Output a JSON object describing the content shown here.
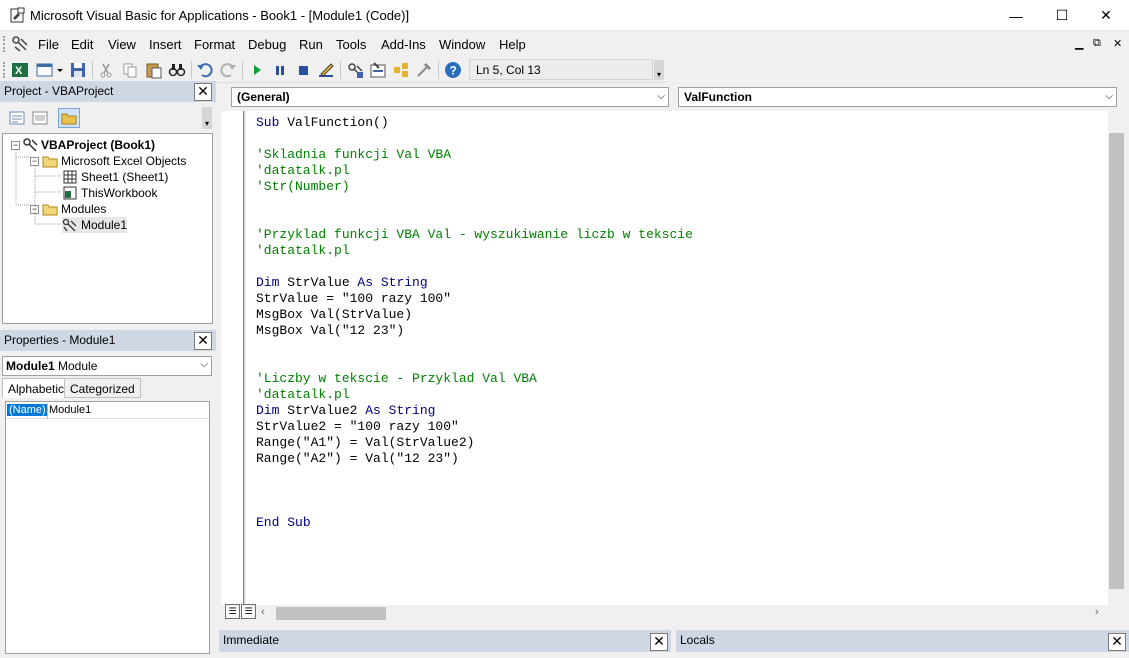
{
  "window": {
    "title": "Microsoft Visual Basic for Applications - Book1 - [Module1 (Code)]",
    "minimize": "—",
    "maximize": "☐",
    "close": "✕"
  },
  "menu": {
    "items": [
      "File",
      "Edit",
      "View",
      "Insert",
      "Format",
      "Debug",
      "Run",
      "Tools",
      "Add-Ins",
      "Window",
      "Help"
    ],
    "mdi_minimize": "▁",
    "mdi_restore": "⧉",
    "mdi_close": "✕"
  },
  "toolbar": {
    "status": "Ln 5, Col 13"
  },
  "project": {
    "title": "Project - VBAProject",
    "close": "✕",
    "tree": {
      "root": "VBAProject (Book1)",
      "folder_objects": "Microsoft Excel Objects",
      "sheet1": "Sheet1 (Sheet1)",
      "workbook": "ThisWorkbook",
      "folder_modules": "Modules",
      "module1": "Module1"
    }
  },
  "properties": {
    "title": "Properties - Module1",
    "close": "✕",
    "object_name": "Module1",
    "object_type": "Module",
    "tabs": [
      "Alphabetic",
      "Categorized"
    ],
    "row_name": "(Name)",
    "row_value": "Module1"
  },
  "code": {
    "object_combo": "(General)",
    "procedure_combo": "ValFunction",
    "lines": [
      {
        "text": "Sub ValFunction()",
        "kind": "keyword"
      },
      {
        "text": "",
        "kind": "plain"
      },
      {
        "text": "'Skladnia funkcji Val VBA",
        "kind": "comment"
      },
      {
        "text": "'datatalk.pl",
        "kind": "comment"
      },
      {
        "text": "'Str(Number)",
        "kind": "comment"
      },
      {
        "text": "",
        "kind": "plain"
      },
      {
        "text": "",
        "kind": "plain"
      },
      {
        "text": "'Przyklad funkcji VBA Val - wyszukiwanie liczb w tekscie",
        "kind": "comment"
      },
      {
        "text": "'datatalk.pl",
        "kind": "comment"
      },
      {
        "text": "",
        "kind": "plain"
      },
      {
        "text": "Dim StrValue As String",
        "kind": "keyword"
      },
      {
        "text": "StrValue = \"100 razy 100\"",
        "kind": "plain"
      },
      {
        "text": "MsgBox Val(StrValue)",
        "kind": "plain"
      },
      {
        "text": "MsgBox Val(\"12 23\")",
        "kind": "plain"
      },
      {
        "text": "",
        "kind": "plain"
      },
      {
        "text": "",
        "kind": "plain"
      },
      {
        "text": "'Liczby w tekscie - Przyklad Val VBA",
        "kind": "comment"
      },
      {
        "text": "'datatalk.pl",
        "kind": "comment"
      },
      {
        "text": "Dim StrValue2 As String",
        "kind": "keyword"
      },
      {
        "text": "StrValue2 = \"100 razy 100\"",
        "kind": "plain"
      },
      {
        "text": "Range(\"A1\") = Val(StrValue2)",
        "kind": "plain"
      },
      {
        "text": "Range(\"A2\") = Val(\"12 23\")",
        "kind": "plain"
      },
      {
        "text": "",
        "kind": "plain"
      },
      {
        "text": "",
        "kind": "plain"
      },
      {
        "text": "",
        "kind": "plain"
      },
      {
        "text": "End Sub",
        "kind": "keyword"
      }
    ]
  },
  "immediate": {
    "title": "Immediate",
    "close": "✕"
  },
  "locals": {
    "title": "Locals",
    "close": "✕"
  },
  "colors": {
    "panel_header": "#ced7e3",
    "comment": "#008000",
    "keyword": "#00007f",
    "selection": "#0078d7"
  }
}
